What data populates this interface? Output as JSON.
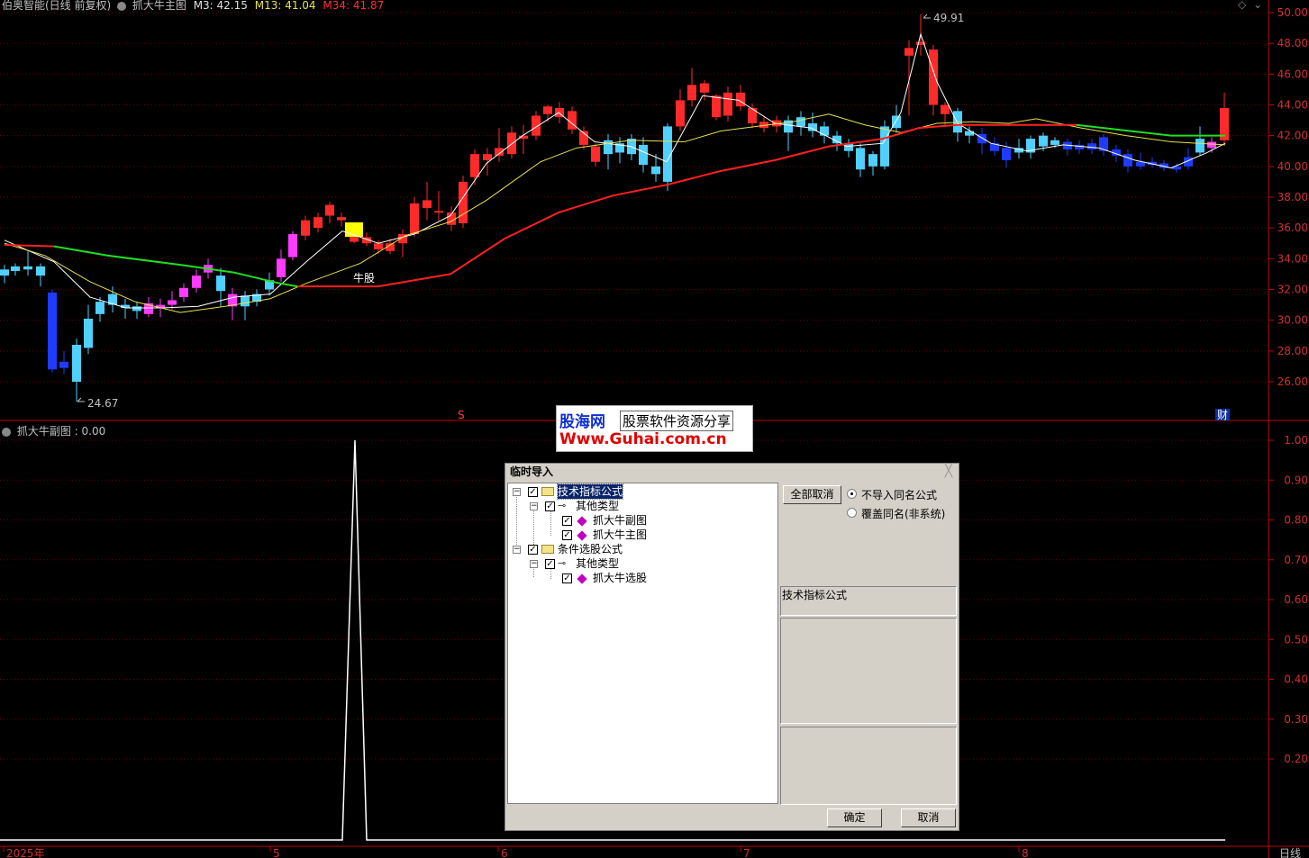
{
  "header": {
    "stock_name": "伯奥智能(日线 前复权)",
    "indicator_name": "抓大牛主图",
    "m3_label": "M3: 42.15",
    "m13_label": "M13: 41.04",
    "m34_label": "M34: 41.87"
  },
  "main_chart": {
    "price_labels": [
      "50.00",
      "48.00",
      "46.00",
      "44.00",
      "42.00",
      "40.00",
      "38.00",
      "36.00",
      "34.00",
      "32.00",
      "30.00",
      "28.00",
      "26.00"
    ],
    "price_values": [
      50,
      48,
      46,
      44,
      42,
      40,
      38,
      36,
      34,
      32,
      30,
      28,
      26
    ],
    "high_marker": "49.91",
    "low_marker": "24.67",
    "signal_text": "牛股",
    "s_marker": "S",
    "cai_marker": "财",
    "colors": {
      "up": "#ff2a2a",
      "down": "#1e3cff",
      "light": "#4fd0ff",
      "magenta": "#ff3cff",
      "m3": "#ffffff",
      "m13": "#e8e050",
      "m34_red": "#ff2020",
      "m34_green": "#20e020"
    }
  },
  "sub_chart": {
    "title": "抓大牛副图 : 0.00",
    "y_labels": [
      "1.00",
      "0.90",
      "0.80",
      "0.70",
      "0.60",
      "0.50",
      "0.40",
      "0.30",
      "0.20"
    ],
    "y_values": [
      1.0,
      0.9,
      0.8,
      0.7,
      0.6,
      0.5,
      0.4,
      0.3,
      0.2
    ]
  },
  "x_axis": {
    "labels": [
      "2025年",
      "5",
      "6",
      "7",
      "8"
    ],
    "period": "日线"
  },
  "watermark": {
    "line1_a": "股海网",
    "line1_b": "股票软件资源分享",
    "line2": "Www.Guhai.com.cn"
  },
  "dialog": {
    "title": "临时导入",
    "close_icon": "close-icon",
    "tree": [
      {
        "label": "技术指标公式",
        "level": 0,
        "checked": true,
        "selected": true,
        "icon": "folder-icon"
      },
      {
        "label": "其他类型",
        "level": 1,
        "checked": true,
        "icon": "key-icon"
      },
      {
        "label": "抓大牛副图",
        "level": 2,
        "checked": true,
        "icon": "formula-icon"
      },
      {
        "label": "抓大牛主图",
        "level": 2,
        "checked": true,
        "icon": "formula-icon"
      },
      {
        "label": "条件选股公式",
        "level": 0,
        "checked": true,
        "icon": "folder-icon"
      },
      {
        "label": "其他类型",
        "level": 1,
        "checked": true,
        "icon": "key-icon"
      },
      {
        "label": "抓大牛选股",
        "level": 2,
        "checked": true,
        "icon": "formula-icon"
      }
    ],
    "deselect_all": "全部取消",
    "radio_skip": "不导入同名公式",
    "radio_overwrite": "覆盖同名(非系统)",
    "info_label": "技术指标公式",
    "ok": "确定",
    "cancel": "取消"
  }
}
